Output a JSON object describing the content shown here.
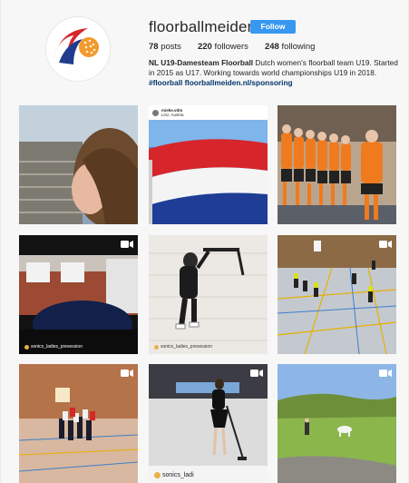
{
  "profile": {
    "username": "floorballmeiden",
    "follow_label": "Follow",
    "posts_count": "78",
    "posts_label": "posts",
    "followers_count": "220",
    "followers_label": "followers",
    "following_count": "248",
    "following_label": "following",
    "bio_name": "NL U19-Damesteam Floorball",
    "bio_text": " Dutch women's floorball team U19. Started in 2015 as U17. Working towards world championships U19 in 2018. ",
    "bio_hashtag": "#floorball",
    "bio_link": "floorballmeiden.nl/sponsoring"
  },
  "posts": [
    {
      "id": 1,
      "kind": "photo",
      "icons": []
    },
    {
      "id": 2,
      "kind": "photo",
      "embed_user": "mieke.vdm",
      "embed_location": "Linz, Austria"
    },
    {
      "id": 3,
      "kind": "photo"
    },
    {
      "id": 4,
      "kind": "video",
      "watermark": "sonics_ladies_presession"
    },
    {
      "id": 5,
      "kind": "photo",
      "watermark": "sonics_ladies_presession"
    },
    {
      "id": 6,
      "kind": "video"
    },
    {
      "id": 7,
      "kind": "video"
    },
    {
      "id": 8,
      "kind": "video",
      "watermark": "sonics_ladi"
    },
    {
      "id": 9,
      "kind": "video"
    }
  ],
  "colors": {
    "follow_button": "#3897f0",
    "link": "#003569",
    "text": "#262626"
  }
}
